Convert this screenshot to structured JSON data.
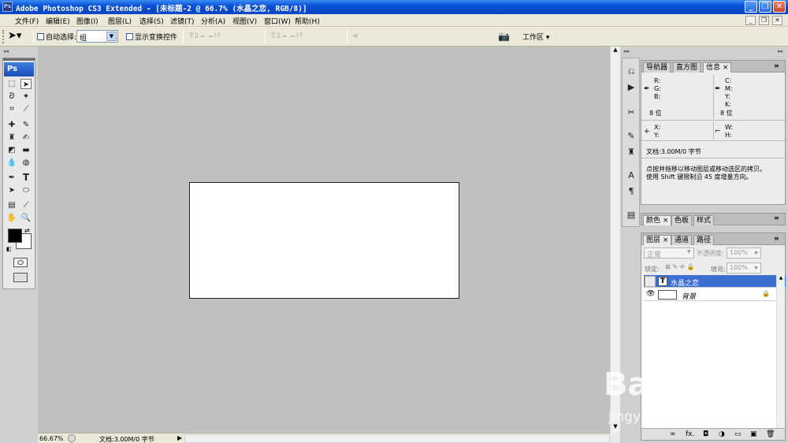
{
  "window": {
    "title": "Adobe Photoshop CS3 Extended - [未标题-2 @ 66.7% (水晶之恋, RGB/8)]",
    "app_icon": "Ps",
    "min": "_",
    "max": "❐",
    "close": "✕"
  },
  "menu": {
    "items": [
      "文件(F)",
      "编辑(E)",
      "图像(I)",
      "图层(L)",
      "选择(S)",
      "滤镜(T)",
      "分析(A)",
      "视图(V)",
      "窗口(W)",
      "帮助(H)"
    ]
  },
  "options": {
    "auto_select_label": "自动选择:",
    "auto_select_value": "组",
    "transform_label": "显示变换控件",
    "workspace_label": "工作区 ▾"
  },
  "toolbox": {
    "logo": "Ps"
  },
  "status": {
    "zoom": "66.67%",
    "doc": "文档:3.00M/0 字节"
  },
  "info_panel": {
    "tabs": [
      "导航器",
      "直方图",
      "信息 ×"
    ],
    "r": "R:",
    "g": "G:",
    "b": "B:",
    "c": "C:",
    "m": "M:",
    "y": "Y:",
    "k": "K:",
    "bit_left": "8 位",
    "bit_right": "8 位",
    "x": "X:",
    "yy": "Y:",
    "w": "W:",
    "h": "H:",
    "doc": "文档:3.00M/0 字节",
    "hint1": "点按并拖移以移动图层或移动选区的拷贝。",
    "hint2": "使用 Shift 键限制沿 45 度增量方向。"
  },
  "color_panel": {
    "tabs": [
      "颜色 ×",
      "色板",
      "样式"
    ]
  },
  "layers_panel": {
    "tabs": [
      "图层 ×",
      "通道",
      "路径"
    ],
    "blend_mode": "正常",
    "opacity_label": "不透明度:",
    "opacity_value": "100%",
    "lock_label": "锁定:",
    "fill_label": "填充:",
    "fill_value": "100%",
    "layers": [
      {
        "name": "水晶之恋",
        "type": "text",
        "thumb": "T"
      },
      {
        "name": "背景",
        "type": "background"
      }
    ],
    "bottom_icons": [
      "∞",
      "fx.",
      "◘",
      "◑",
      "▭",
      "▣",
      "🗑"
    ]
  },
  "watermark": {
    "brand": "Bai 经验",
    "url": "jingyan.baidu.com"
  }
}
